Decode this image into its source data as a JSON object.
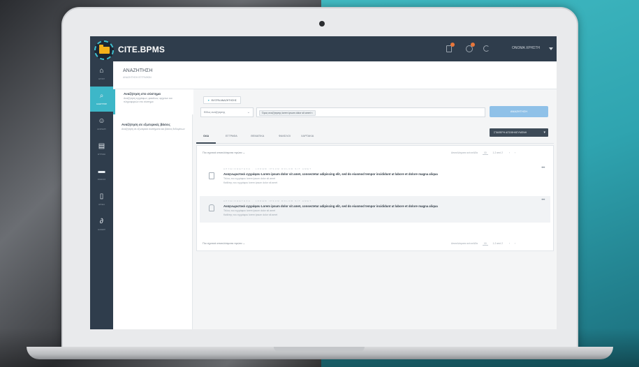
{
  "app": {
    "brand": "CITE.BPMS",
    "username": "ΟΝΟΜΑ ΧΡΗΣΤΗ"
  },
  "sidebar": {
    "items": [
      {
        "label": "ΑΡΧΙΚΗ",
        "icon": "home-icon",
        "glyph": "⌂"
      },
      {
        "label": "ΑΝΑΖΗΤΗΣΗ",
        "icon": "search-icon",
        "glyph": "⌕"
      },
      {
        "label": "ΕΚΚΡΕΜΗ",
        "icon": "tasks-icon",
        "glyph": "☺"
      },
      {
        "label": "ΕΓΓΡΑΦΑ",
        "icon": "document-icon",
        "glyph": "▤"
      },
      {
        "label": "ΦΑΚΕΛΟΙ",
        "icon": "folder-icon",
        "glyph": "▬"
      },
      {
        "label": "ΑΡΧΕΙΑ",
        "icon": "file-icon",
        "glyph": "▯"
      },
      {
        "label": "ΔΙΑΘΕΣΗ",
        "icon": "workflow-icon",
        "glyph": "∂"
      }
    ],
    "active_index": 1
  },
  "page": {
    "title": "ΑΝΑΖΗΤΗΣΗ",
    "subtitle": "ΑΝΑΖΗΤΗΣΗ ΕΓΓΡΑΦΩΝ"
  },
  "scopes": [
    {
      "title": "Αναζήτηση στο σύστημα",
      "desc": "Αναζήτηση εγγράφων, φακέλων, αρχείων και πληροφοριών στο σύστημα"
    },
    {
      "title": "Αναζήτηση σε εξωτερικές βάσεις",
      "desc": "Αναζήτηση σε εξωτερικά συστήματα και βάσεις δεδομένων"
    }
  ],
  "search": {
    "filter_label": "ΦΙΛΤΡΑ ΑΝΑΖΗΤΗΣΗΣ",
    "type_select": "Είδος αναζήτησης",
    "term_chip": "Όρος αναζήτησης lorem ipsum dolor sit amet",
    "chip_close": "×",
    "button": "ΑΝΑΖΗΤΗΣΗ"
  },
  "tabs": [
    "ΟΛΑ",
    "ΕΓΓΡΑΦΑ",
    "ΘΕΜΑΤΙΚΑ",
    "ΦΑΚΕΛΟΙ",
    "ΧΑΡΤΑΚΙΑ"
  ],
  "save_button": "ΣΤΑΘΕΡΗ ΑΠΟΘΗΚΕΥΜΕΝΗ",
  "results": {
    "sort_label": "Πιο σχετικά αποτελέσματα πρώτα",
    "per_page_label": "Αποτελέσματα ανά σελίδα",
    "per_page": "10",
    "range": "1-2 από 2",
    "items": [
      {
        "path": "ΑΡΧΕΙΟΘΕΤΗΣΗ · LOREM IPSUM DOLOR SIT AMET",
        "title": "Αναγνωριστικό εγγράφου Lorem ipsum dolor sit amet, consectetur adipiscing elit, sed do eiusmod tempor incididunt ut labore et dolore magna aliqua",
        "meta1": "Τίτλος του εγγράφου lorem ipsum dolor sit amet",
        "meta2": "Καθέτης του εγγράφου lorem ipsum dolor sit amet",
        "icon": "document-icon"
      },
      {
        "path": "ΑΡΧΕΙΟΘΕΤΗΣΗ · LOREM IPSUM DOLOR SIT AMET",
        "title": "Αναγνωριστικό εγγράφου Lorem ipsum dolor sit amet, consectetur adipiscing elit, sed do eiusmod tempor incididunt ut labore et dolore magna aliqua",
        "meta1": "Τίτλος του εγγράφου lorem ipsum dolor sit amet",
        "meta2": "Καθέτης του εγγράφου lorem ipsum dolor sit amet",
        "icon": "record-icon"
      }
    ],
    "more": "•••"
  },
  "colors": {
    "topbar": "#2f3d4c",
    "accent": "#3db7c8",
    "primary_button": "#8fc1e8",
    "badge": "#e8763a"
  }
}
